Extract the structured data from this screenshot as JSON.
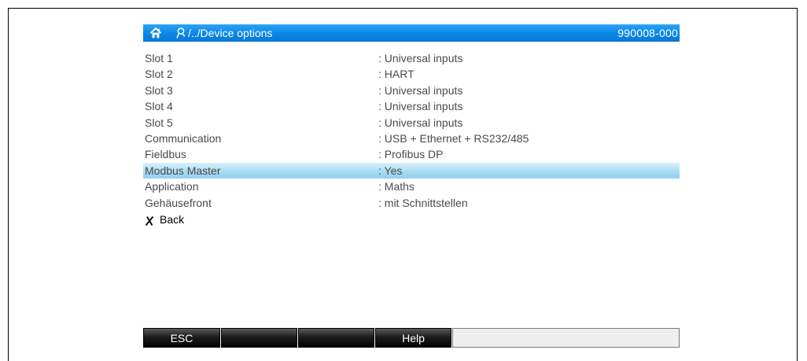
{
  "titlebar": {
    "path": "/../Device options",
    "device_id": "990008-000",
    "background": "#0a86e6",
    "home_icon": "home-icon",
    "path_icon": "user-path-icon"
  },
  "rows": [
    {
      "label": "Slot 1",
      "value": ": Universal inputs"
    },
    {
      "label": "Slot 2",
      "value": ": HART"
    },
    {
      "label": "Slot 3",
      "value": ": Universal inputs"
    },
    {
      "label": "Slot 4",
      "value": ": Universal inputs"
    },
    {
      "label": "Slot 5",
      "value": ": Universal inputs"
    },
    {
      "label": "Communication",
      "value": ": USB + Ethernet + RS232/485"
    },
    {
      "label": "Fieldbus",
      "value": ": Profibus DP"
    },
    {
      "label": "Modbus Master",
      "value": ": Yes"
    },
    {
      "label": "Application",
      "value": ": Maths"
    },
    {
      "label": "Gehäusefront",
      "value": ": mit Schnittstellen"
    }
  ],
  "selected_row": "Modbus Master",
  "selected_color": "#aadcf3",
  "back": {
    "label": "Back",
    "icon": "x-back-icon"
  },
  "softkeys": [
    {
      "label": "ESC"
    },
    {
      "label": ""
    },
    {
      "label": ""
    },
    {
      "label": "Help"
    },
    {
      "label": ""
    }
  ]
}
